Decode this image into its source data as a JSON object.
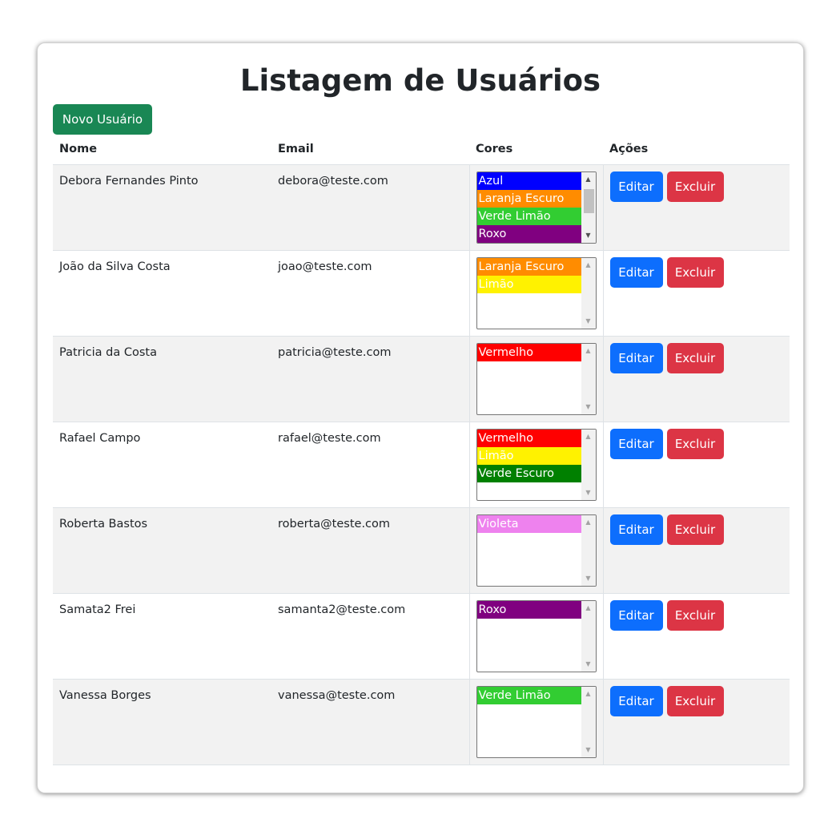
{
  "title": "Listagem de Usuários",
  "new_button_label": "Novo Usuário",
  "columns": [
    "Nome",
    "Email",
    "Cores",
    "Ações"
  ],
  "edit_label": "Editar",
  "delete_label": "Excluir",
  "colors": {
    "new_button": "#198754",
    "edit_button": "#0d6efd",
    "delete_button": "#dc3545"
  },
  "users": [
    {
      "name": "Debora Fernandes Pinto",
      "email": "debora@teste.com",
      "cores": [
        {
          "label": "Azul",
          "bg": "#0000ff",
          "fg": "#ffffff"
        },
        {
          "label": "Laranja Escuro",
          "bg": "#ff8c00",
          "fg": "#ffffff"
        },
        {
          "label": "Verde Limão",
          "bg": "#32cd32",
          "fg": "#ffffff"
        },
        {
          "label": "Roxo",
          "bg": "#800080",
          "fg": "#ffffff"
        }
      ]
    },
    {
      "name": "João da Silva Costa",
      "email": "joao@teste.com",
      "cores": [
        {
          "label": "Laranja Escuro",
          "bg": "#ff8c00",
          "fg": "#ffffff"
        },
        {
          "label": "Limão",
          "bg": "#fff200",
          "fg": "#ffffff"
        }
      ]
    },
    {
      "name": "Patricia da Costa",
      "email": "patricia@teste.com",
      "cores": [
        {
          "label": "Vermelho",
          "bg": "#ff0000",
          "fg": "#ffffff"
        }
      ]
    },
    {
      "name": "Rafael Campo",
      "email": "rafael@teste.com",
      "cores": [
        {
          "label": "Vermelho",
          "bg": "#ff0000",
          "fg": "#ffffff"
        },
        {
          "label": "Limão",
          "bg": "#fff200",
          "fg": "#ffffff"
        },
        {
          "label": "Verde Escuro",
          "bg": "#008000",
          "fg": "#ffffff"
        }
      ]
    },
    {
      "name": "Roberta Bastos",
      "email": "roberta@teste.com",
      "cores": [
        {
          "label": "Violeta",
          "bg": "#ee82ee",
          "fg": "#ffffff"
        }
      ]
    },
    {
      "name": "Samata2 Frei",
      "email": "samanta2@teste.com",
      "cores": [
        {
          "label": "Roxo",
          "bg": "#800080",
          "fg": "#ffffff"
        }
      ]
    },
    {
      "name": "Vanessa Borges",
      "email": "vanessa@teste.com",
      "cores": [
        {
          "label": "Verde Limão",
          "bg": "#32cd32",
          "fg": "#ffffff"
        }
      ]
    }
  ]
}
